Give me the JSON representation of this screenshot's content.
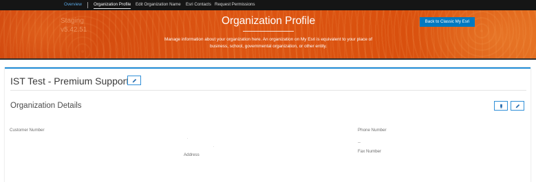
{
  "topnav": {
    "items": [
      {
        "label": "Overview"
      },
      {
        "label": "Organization Profile"
      },
      {
        "label": "Edit Organization Name"
      },
      {
        "label": "Esri Contacts"
      },
      {
        "label": "Request Permissions"
      }
    ],
    "active_item": "Organization Profile"
  },
  "banner": {
    "environment": "Staging",
    "version": "v5.42.51",
    "title": "Organization Profile",
    "description": "Manage information about your organization here. An organization on My Esri is equivalent to your place of business, school, governmental organization, or other entity.",
    "back_button": "Back to Classic My Esri"
  },
  "card": {
    "org_name": "IST Test - Premium Support",
    "section_title": "Organization Details",
    "fields": {
      "customer_number_label": "Customer Number",
      "phone_number_label": "Phone Number",
      "phone_number_value": "--",
      "fax_number_label": "Fax Number",
      "address_label": "Address"
    },
    "marks": [
      ".",
      "."
    ]
  },
  "icons": {
    "edit_name": "pencil-icon",
    "upload": "upload-icon",
    "edit_details": "pencil-icon"
  },
  "colors": {
    "nav_bg": "#151515",
    "banner_orange": "#d9500e",
    "accent_blue": "#0079c1",
    "card_border": "#1e8bd6"
  }
}
